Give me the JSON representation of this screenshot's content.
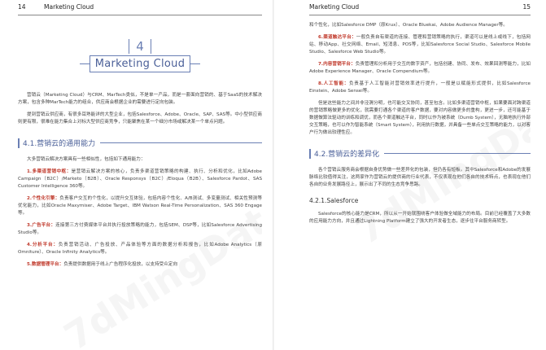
{
  "left_page": {
    "page_number": "14",
    "running_head": "Marketing Cloud",
    "chapter_number": "4",
    "chapter_title": "Marketing Cloud",
    "intro_p1": "营销云（Marketing Cloud）与CRM、MarTech类似，不是单一产品，而是一套面向营销的、基于SaaS的技术解决方案，包含多种MarTech能力的组合，供应商会根据企业的需要进行定向包装。",
    "intro_p2": "提到营销云供应商，有很多耳熟能详的大型企业，包括Salesforce、Adobe、Oracle、SAP、SAS等。中小型供应商则更有限，很难在能力集合上对标大型供应商竞争，只能聚焦在某一个细分市场或解决某一个单点问题。",
    "section_title": "4.1.营销云的通用能力",
    "section_intro": "大多营销云解决方案具有一些相似性，包括如下通用能力：",
    "items": [
      {
        "label": "1.多渠道营销中枢：",
        "text": "是营销云解决方案的核心，负责多渠道营销策略的构建、执行、分析和优化，比如Adobe Campaign（B2C）/Marketo（B2B）、Oracle Responsys（B2C）/Eloqua（B2B）、Salesforce Pardot、SAS Customer Intelligence 360等。"
      },
      {
        "label": "2.个性化引擎：",
        "text": "负责客户交互的个性化，以提升交互体验，包括内容个性化、A/B测试、多变量测试、相关性预测等优化能力，比如Oracle Maxymiser、Adobe Target、IBM Watson Real-Time Personalization、SAS 360 Engage等。"
      },
      {
        "label": "3.广告平台：",
        "text": "连接第三方付费媒体平台并执行投放策略的能力，包括SEM、DSP等，比如Salesforce Advertising Studio等。"
      },
      {
        "label": "4.分析平台：",
        "text": "负责营销活动、广告投放、产品体验等方面的数据分析和报告，比如Adobe Analytics（原Omniture）、Oracle Infinity Analytics等。"
      },
      {
        "label": "5.数据管理平台：",
        "text": "负责提供数据用于线上广告程序化投放，以支持受众定向"
      }
    ]
  },
  "right_page": {
    "page_number": "15",
    "running_head": "Marketing Cloud",
    "cont_text": "和个性化，比如Salesforce DMP（原Krux）、Oracle Bluekai、Adobe Audience Manager等。",
    "items": [
      {
        "label": "6.渠道触达平台：",
        "text": "一般负责自有渠道的连接、管理和营销策略的执行，渠道可以是线上或线下，包括网站、移动App、社交网络、Email、短消息、POS等，比如Salesforce Social Studio、Salesforce Mobile Studio、Salesforce Web Studio等。"
      },
      {
        "label": "7.内容营销平台：",
        "text": "负责管理和分析用于交互的数字资产，包括创建、协同、发布、效果回测等能力，比如Adobe Experience Manager、Oracle Compendium等。"
      },
      {
        "label": "8.人工智能：",
        "text": "负责基于人工智能对营销效率进行提升，一般是以赋能形式提供，比如Salesforce Einstein、Adobe Sensei等。"
      }
    ],
    "para": "但是这些能力之间并非泾渭分明，也可能交叉协同，甚至包含。比如多渠道营销中枢，如果要面对跨渠道的营销策略做更多的优化，就需要打通各个渠道的客户数据，要对内容做更多的重构，更进一步，还可能基于数据做算法驱动的训练和调优，而各个渠道触达平台，同时以作为被系统（Dumb System），无脑地执行外部交互策略，也可以作为智能系统（Smart System），利用执行数据，并具备一些单点交互策略的能力，以对客户行为做出较理性应。",
    "section_title": "4.2.营销云的差异化",
    "section_para": "各个营销云服务商会根据自身优势做一些差异化的包装，但仍各有短板。其中Salesforce和Adobe的发展脉络比较值得关注，这两家作为营销云的提供商的行业代表，不仅表现在他们各自的技术特点，也表现在他们各自的业务发展路径上，展示出了不同的生态竞争思路。",
    "sub_title": "4.2.1.Salesforce",
    "sub_para": "Salesforce的核心能力是CRM，所以从一开始就围绕客户体验做全域能力的布局。目前已经覆盖了大多数的应用能力方向，并且通过Lightning Platform建立了强大的开发者生态，逐步往平台服务商转型。"
  },
  "watermark": "7dMingDataHub"
}
